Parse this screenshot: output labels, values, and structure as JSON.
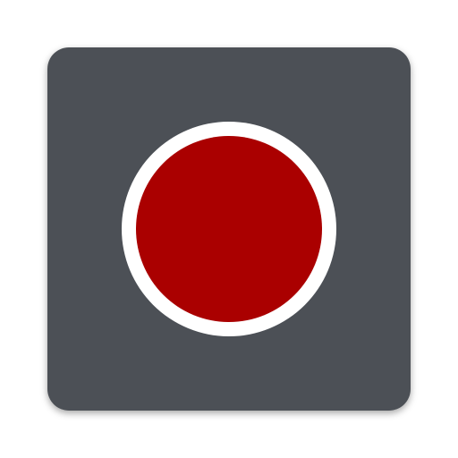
{
  "app_icon": {
    "icon": "record-icon",
    "colors": {
      "tile_background": "#4c5056",
      "ring": "#ffffff",
      "record_dot": "#aa0000"
    }
  }
}
